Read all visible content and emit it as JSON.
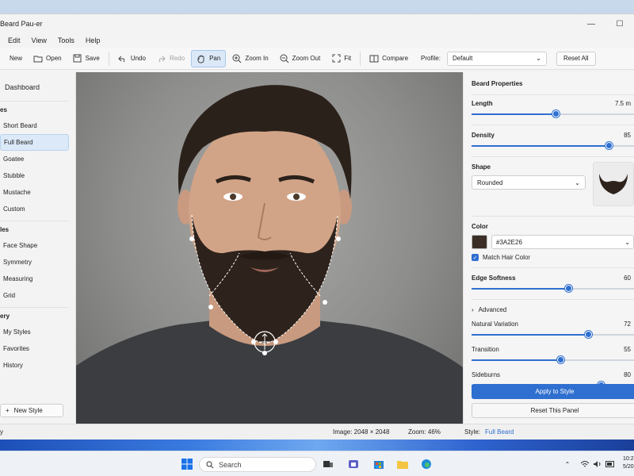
{
  "window": {
    "title": "Beard Pau-er"
  },
  "window_controls": {
    "minimize": "—",
    "maximize": "☐"
  },
  "menu": [
    "Edit",
    "View",
    "Tools",
    "Help"
  ],
  "toolbar": {
    "new": "New",
    "open": "Open",
    "save": "Save",
    "undo": "Undo",
    "redo": "Redo",
    "pan": "Pan",
    "zoom_in": "Zoom In",
    "zoom_out": "Zoom Out",
    "fit": "Fit",
    "compare": "Compare",
    "profile_label": "Profile:",
    "profile_value": "Default",
    "reset_all": "Reset All"
  },
  "sidebar": {
    "dashboard": "Dashboard",
    "section1_title": "es",
    "styles": [
      "Short Beard",
      "Full Beard",
      "Goatee",
      "Stubble",
      "Mustache",
      "Custom"
    ],
    "selected_style": "Full Beard",
    "section2_title": "les",
    "tools": [
      "Face Shape",
      "Symmetry",
      "Measuring",
      "Grid"
    ],
    "section3_title": "ery",
    "library": [
      "My Styles",
      "Favorites",
      "History"
    ],
    "new_style": "New Style"
  },
  "panel": {
    "title": "Beard Properties",
    "length_label": "Length",
    "length_value": "7.5 m",
    "length_level": 0.52,
    "density_label": "Density",
    "density_value": "85",
    "density_level": 0.85,
    "shape_label": "Shape",
    "shape_value": "Rounded",
    "color_label": "Color",
    "color_hex": "#3A2E26",
    "color_swatch": "#3a2e26",
    "match_hair_label": "Match Hair Color",
    "edge_label": "Edge Softness",
    "edge_value": "60",
    "edge_level": 0.6,
    "advanced_label": "Advanced",
    "natural_label": "Natural Variation",
    "natural_value": "72",
    "natural_level": 0.72,
    "transition_label": "Transition",
    "transition_value": "55",
    "transition_level": 0.55,
    "sideburns_label": "Sideburns",
    "sideburns_value": "80",
    "sideburns_level": 0.8,
    "apply": "Apply to Style",
    "reset_panel": "Reset This Panel"
  },
  "status": {
    "left": "y",
    "image": "Image: 2048 × 2048",
    "zoom": "Zoom: 46%",
    "style_label": "Style:",
    "style_value": "Full Beard"
  },
  "taskbar": {
    "search": "Search",
    "time": "10:2",
    "date": "5/20"
  },
  "colors": {
    "accent": "#2f6fd0",
    "selected_bg": "#dce9f8"
  }
}
